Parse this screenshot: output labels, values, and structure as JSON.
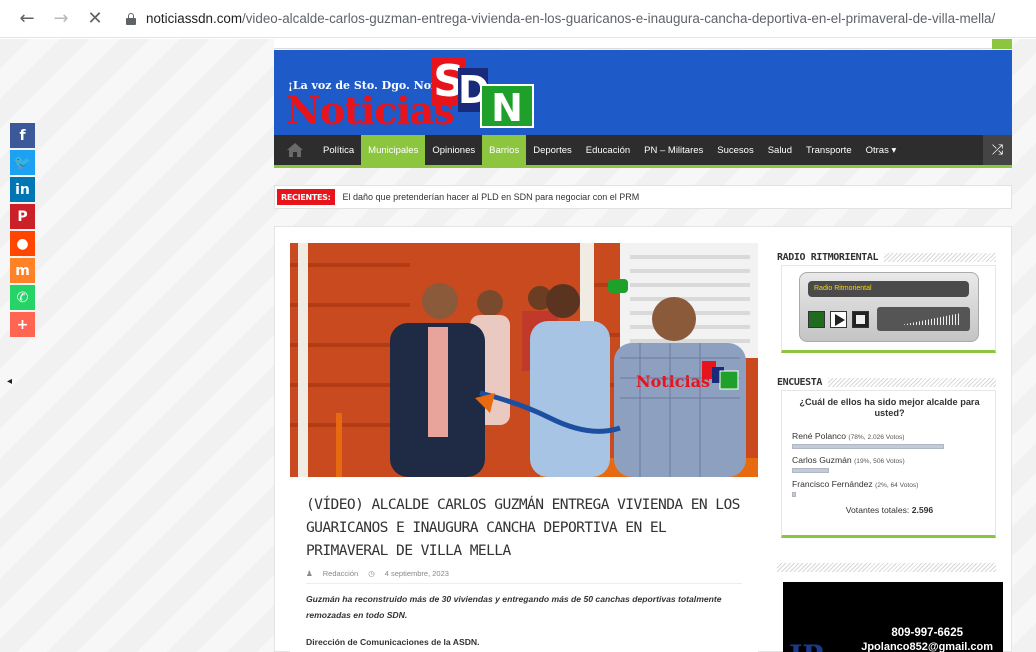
{
  "browser": {
    "back_icon": "←",
    "forward_icon": "→",
    "stop_icon": "✕",
    "url_host": "noticiassdn.com",
    "url_path": "/video-alcalde-carlos-guzman-entrega-vivienda-en-los-guaricanos-e-inaugura-cancha-deportiva-en-el-primaveral-de-villa-mella/"
  },
  "header": {
    "tagline": "¡La voz de Sto. Dgo. Norte!",
    "logo_word": "Noticias",
    "logo_s": "S",
    "logo_d": "D",
    "logo_n": "N",
    "brand_red": "#e8141c",
    "brand_blue": "#1e5ac8",
    "brand_green": "#1ea02a"
  },
  "nav": {
    "items": [
      {
        "label": "Política",
        "active": false
      },
      {
        "label": "Municipales",
        "active": true
      },
      {
        "label": "Opiniones",
        "active": false
      },
      {
        "label": "Barrios",
        "active": true
      },
      {
        "label": "Deportes",
        "active": false
      },
      {
        "label": "Educación",
        "active": false
      },
      {
        "label": "PN – Militares",
        "active": false
      },
      {
        "label": "Sucesos",
        "active": false
      },
      {
        "label": "Salud",
        "active": false
      },
      {
        "label": "Transporte",
        "active": false
      },
      {
        "label": "Otras ▾",
        "active": false
      }
    ],
    "shuffle_icon": "⤮",
    "accent": "#8cc63f"
  },
  "breaking": {
    "label": "RECIENTES:",
    "text": "El daño que pretenderían hacer al PLD en SDN para negociar con el PRM"
  },
  "article": {
    "title": "(VÍDEO) ALCALDE CARLOS GUZMÁN ENTREGA VIVIENDA EN LOS GUARICANOS E INAUGURA CANCHA DEPORTIVA EN EL PRIMAVERAL DE VILLA MELLA",
    "author": "Redacción",
    "date": "4 septiembre, 2023",
    "excerpt": "Guzmán ha reconstruido más de 30 viviendas y entregando más de 50 canchas deportivas totalmente remozadas en todo SDN.",
    "section": "Dirección de Comunicaciones de la ASDN.",
    "photo_watermark": "Noticias"
  },
  "sidebar": {
    "radio": {
      "title": "RADIO RITMORIENTAL",
      "station": "Radio Ritmoriental"
    },
    "poll": {
      "title": "ENCUESTA",
      "question": "¿Cuál de ellos ha sido mejor alcalde para usted?",
      "options": [
        {
          "name": "René Polanco",
          "detail": "(78%, 2.026 Votos)",
          "pct": 78
        },
        {
          "name": "Carlos Guzmán",
          "detail": "(19%, 506 Votos)",
          "pct": 19
        },
        {
          "name": "Francisco Fernández",
          "detail": "(2%, 64 Votos)",
          "pct": 2
        }
      ],
      "total_label": "Votantes totales:",
      "total_value": "2.596"
    },
    "ad": {
      "phone": "809-997-6625",
      "email": "Jpolanco852@gmail.com"
    }
  },
  "share": [
    {
      "name": "facebook-icon",
      "glyph": "f",
      "color": "#3b5998"
    },
    {
      "name": "twitter-icon",
      "glyph": "🐦",
      "color": "#1da1f2"
    },
    {
      "name": "linkedin-icon",
      "glyph": "in",
      "color": "#0077b5"
    },
    {
      "name": "pinterest-icon",
      "glyph": "P",
      "color": "#cb2027"
    },
    {
      "name": "reddit-icon",
      "glyph": "●",
      "color": "#ff4500"
    },
    {
      "name": "mix-icon",
      "glyph": "m",
      "color": "#ff8226"
    },
    {
      "name": "whatsapp-icon",
      "glyph": "✆",
      "color": "#25d366"
    },
    {
      "name": "more-icon",
      "glyph": "+",
      "color": "#ff6550"
    }
  ],
  "share_toggle": "◂"
}
